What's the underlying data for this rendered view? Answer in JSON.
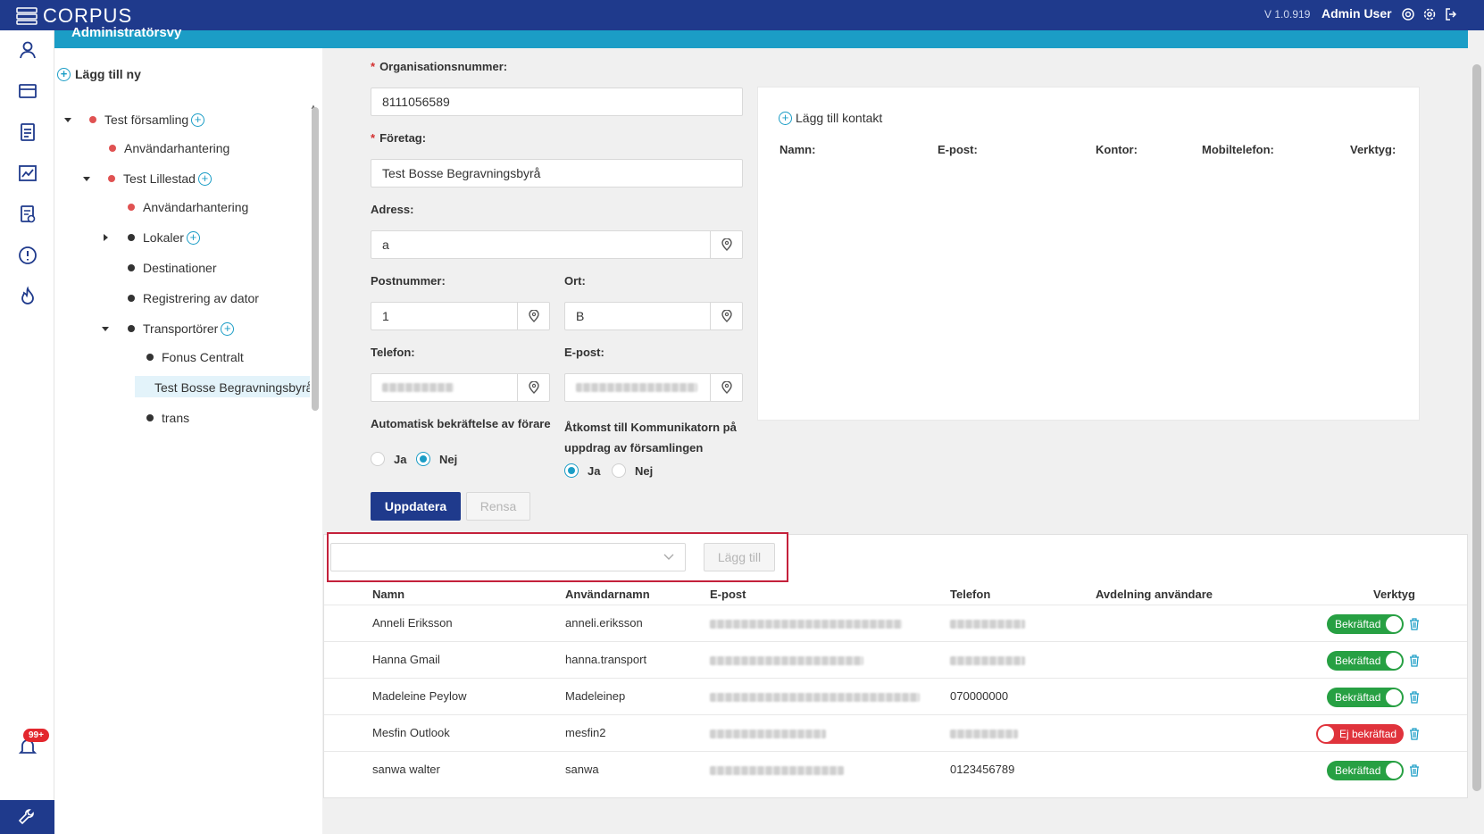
{
  "app": {
    "logo_text": "CORPUS",
    "version": "V 1.0.919",
    "user": "Admin User",
    "header_title": "Administratörsvy",
    "notification_count": "99+"
  },
  "tree": {
    "add_new_label": "Lägg till ny",
    "nodes": [
      {
        "label": "Test församling"
      },
      {
        "label": "Användarhantering"
      },
      {
        "label": "Test Lillestad"
      },
      {
        "label": "Användarhantering"
      },
      {
        "label": "Lokaler"
      },
      {
        "label": "Destinationer"
      },
      {
        "label": "Registrering av dator"
      },
      {
        "label": "Transportörer"
      },
      {
        "label": "Fonus Centralt"
      },
      {
        "label": "Test Bosse Begravningsbyrå"
      },
      {
        "label": "trans"
      }
    ]
  },
  "form": {
    "org_label": "Organisationsnummer",
    "org_value": "8111056589",
    "company_label": "Företag",
    "company_value": "Test Bosse Begravningsbyrå",
    "address_label": "Adress",
    "address_value": "a",
    "postal_label": "Postnummer",
    "postal_value": "1",
    "city_label": "Ort",
    "city_value": "B",
    "phone_label": "Telefon",
    "email_label": "E-post",
    "auto_confirm_label": "Automatisk bekräftelse av förare",
    "comm_access_label": "Åtkomst till Kommunikatorn på uppdrag av församlingen",
    "yes": "Ja",
    "no": "Nej",
    "update_btn": "Uppdatera",
    "clear_btn": "Rensa"
  },
  "contacts": {
    "add_label": "Lägg till kontakt",
    "columns": [
      "Namn:",
      "E-post:",
      "Kontor:",
      "Mobiltelefon:",
      "Verktyg:"
    ]
  },
  "users": {
    "add_btn": "Lägg till",
    "columns": [
      "Namn",
      "Användarnamn",
      "E-post",
      "Telefon",
      "Avdelning användare",
      "Verktyg"
    ],
    "rows": [
      {
        "name": "Anneli Eriksson",
        "username": "anneli.eriksson",
        "phone": "",
        "status": "Bekräftad",
        "confirmed": true
      },
      {
        "name": "Hanna Gmail",
        "username": "hanna.transport",
        "phone": "",
        "status": "Bekräftad",
        "confirmed": true
      },
      {
        "name": "Madeleine Peylow",
        "username": "Madeleinep",
        "phone": "070000000",
        "status": "Bekräftad",
        "confirmed": true
      },
      {
        "name": "Mesfin Outlook",
        "username": "mesfin2",
        "phone": "",
        "status": "Ej bekräftad",
        "confirmed": false
      },
      {
        "name": "sanwa walter",
        "username": "sanwa",
        "phone": "0123456789",
        "status": "Bekräftad",
        "confirmed": true
      }
    ]
  },
  "colors": {
    "primary": "#1f3a8c",
    "accent": "#1b9dc6",
    "confirmed": "#27a043",
    "unconfirmed": "#e0333c",
    "highlight_border": "#c4213b"
  }
}
